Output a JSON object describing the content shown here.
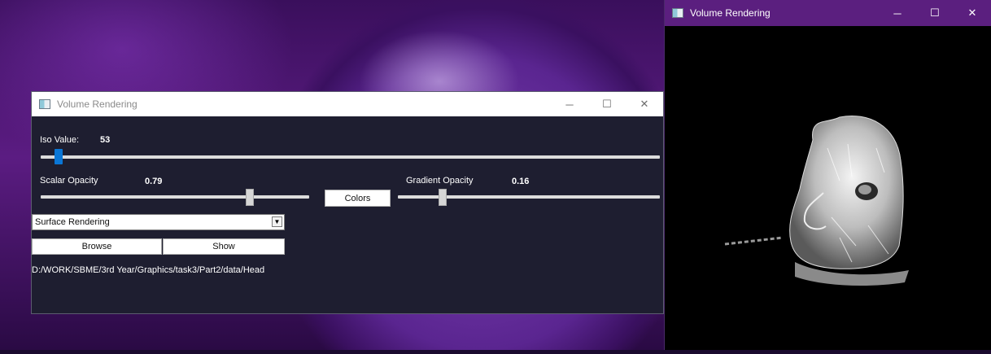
{
  "desktop": {
    "wallpaper": "purple planet wallpaper"
  },
  "main_window": {
    "title": "Volume Rendering",
    "controls": {
      "minimize": "─",
      "maximize": "☐",
      "close": "✕"
    },
    "iso": {
      "label": "Iso Value:",
      "value": "53",
      "fraction": 0.03
    },
    "scalar_opacity": {
      "label": "Scalar Opacity",
      "value": "0.79",
      "fraction": 0.79
    },
    "colors_button": "Colors",
    "gradient_opacity": {
      "label": "Gradient Opacity",
      "value": "0.16",
      "fraction": 0.16
    },
    "mode_select": {
      "selected": "Surface Rendering"
    },
    "browse_button": "Browse",
    "show_button": "Show",
    "path": "D:/WORK/SBME/3rd Year/Graphics/task3/Part2/data/Head"
  },
  "render_window": {
    "title": "Volume Rendering",
    "controls": {
      "minimize": "─",
      "maximize": "☐",
      "close": "✕"
    }
  },
  "colors": {
    "render_titlebar": "#5b1f7f",
    "slider_handle": "#0a76d6",
    "panel_bg": "#1e1e30"
  }
}
